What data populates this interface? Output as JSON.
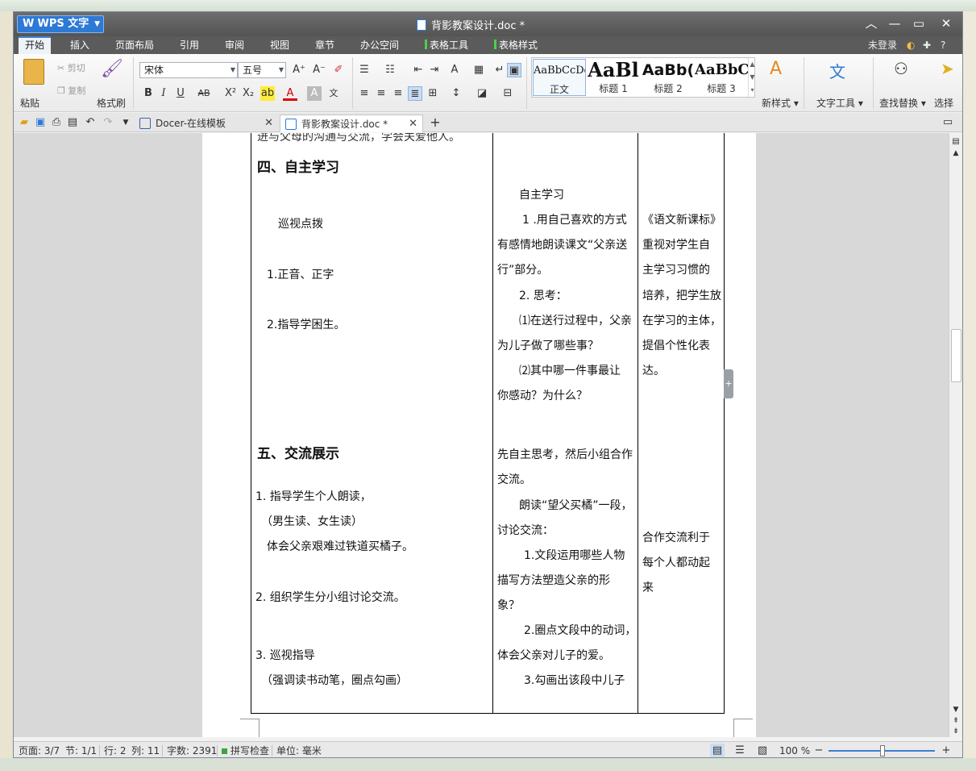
{
  "window": {
    "app_name": "WPS 文字",
    "doc_title": "背影教案设计.doc *"
  },
  "menu": {
    "items": [
      "开始",
      "插入",
      "页面布局",
      "引用",
      "审阅",
      "视图",
      "章节",
      "办公空间"
    ],
    "context_tabs": [
      "表格工具",
      "表格样式"
    ],
    "login": "未登录",
    "help": "?"
  },
  "ribbon": {
    "paste": "粘贴",
    "cut": "剪切",
    "copy": "复制",
    "format_painter": "格式刷",
    "font_name": "宋体",
    "font_size": "五号",
    "styles": [
      {
        "sample": "AaBbCcDd",
        "name": "正文"
      },
      {
        "sample": "AaBl",
        "name": "标题 1"
      },
      {
        "sample": "AaBb(",
        "name": "标题 2"
      },
      {
        "sample": "AaBbC",
        "name": "标题 3"
      }
    ],
    "new_style": "新样式",
    "text_tools": "文字工具",
    "find_replace": "查找替换",
    "select": "选择"
  },
  "tabs": [
    {
      "label": "Docer-在线模板"
    },
    {
      "label": "背影教案设计.doc *"
    }
  ],
  "document": {
    "top_cut_text": "进与父母的沟通与交流，学会关爱他人。",
    "section4": {
      "heading": "四、自主学习",
      "col1": [
        "巡视点拨",
        "1.正音、正字",
        "2.指导学困生。"
      ],
      "col2": [
        "自主学习",
        "1 .用自己喜欢的方式",
        "有感情地朗读课文“父亲送",
        "行”部分。",
        "2. 思考：",
        "⑴在送行过程中，父亲",
        "为儿子做了哪些事？",
        "⑵其中哪一件事最让",
        "你感动？为什么？"
      ],
      "col3": [
        "《语文新课标》",
        "重视对学生自",
        "主学习习惯的",
        "培养，把学生放",
        "在学习的主体，",
        "提倡个性化表",
        "达。"
      ]
    },
    "section5": {
      "heading": "五、交流展示",
      "col1": [
        "1.   指导学生个人朗读，",
        "（男生读、女生读）",
        "体会父亲艰难过铁道买橘子。",
        "2.   组织学生分小组讨论交流。",
        "3.   巡视指导",
        "（强调读书动笔，圈点勾画）"
      ],
      "col2": [
        "先自主思考，然后小组合作",
        "交流。",
        "朗读“望父买橘”一段，",
        "讨论交流：",
        "1.文段运用哪些人物",
        "描写方法塑造父亲的形",
        "象？",
        "2.圈点文段中的动词，",
        "体会父亲对儿子的爱。",
        "3.勾画出该段中儿子"
      ],
      "col3": [
        "合作交流利于",
        "每个人都动起",
        "来"
      ]
    }
  },
  "status": {
    "page": "页面: 3/7",
    "section": "节: 1/1",
    "row": "行: 2",
    "col": "列: 11",
    "words": "字数: 2391",
    "spell": "拼写检查",
    "unit": "单位: 毫米",
    "zoom": "100 %"
  },
  "colors": {
    "accent": "#2d79d6",
    "title_bg": "#545454",
    "context_tab_marker": "#4cd04c"
  }
}
